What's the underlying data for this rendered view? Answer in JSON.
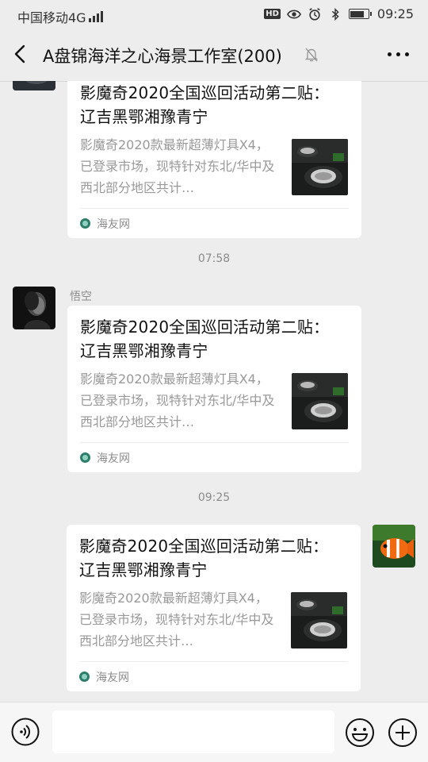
{
  "status_bar": {
    "carrier": "中国移动4G",
    "network_badge": "4G",
    "hd_badge": "HD",
    "time": "09:25",
    "battery_level": 0.85
  },
  "header": {
    "title": "A盘锦海洋之心海景工作室(200)",
    "back_icon": "chevron-left-icon",
    "mute_icon": "bell-off-icon",
    "more_icon": "more-horizontal-icon"
  },
  "messages": [
    {
      "type": "link-card",
      "direction": "incoming",
      "title": "影魔奇2020全国巡回活动第二贴： 辽吉黑鄂湘豫青宁",
      "description": "影魔奇2020款最新超薄灯具X4，已登录市场，现特针对东北/华中及西北部分地区共计…",
      "source": "海友网"
    },
    {
      "type": "timestamp",
      "text": "07:58"
    },
    {
      "type": "link-card",
      "direction": "incoming",
      "sender": "悟空",
      "title": "影魔奇2020全国巡回活动第二贴： 辽吉黑鄂湘豫青宁",
      "description": "影魔奇2020款最新超薄灯具X4，已登录市场，现特针对东北/华中及西北部分地区共计…",
      "source": "海友网"
    },
    {
      "type": "timestamp",
      "text": "09:25"
    },
    {
      "type": "link-card",
      "direction": "outgoing",
      "title": "影魔奇2020全国巡回活动第二贴： 辽吉黑鄂湘豫青宁",
      "description": "影魔奇2020款最新超薄灯具X4，已登录市场，现特针对东北/华中及西北部分地区共计…",
      "source": "海友网"
    }
  ],
  "input_bar": {
    "voice_icon": "voice-icon",
    "emoji_icon": "emoji-icon",
    "plus_icon": "plus-icon",
    "placeholder": ""
  },
  "colors": {
    "background": "#ededed",
    "card": "#ffffff",
    "muted_text": "#999999"
  }
}
